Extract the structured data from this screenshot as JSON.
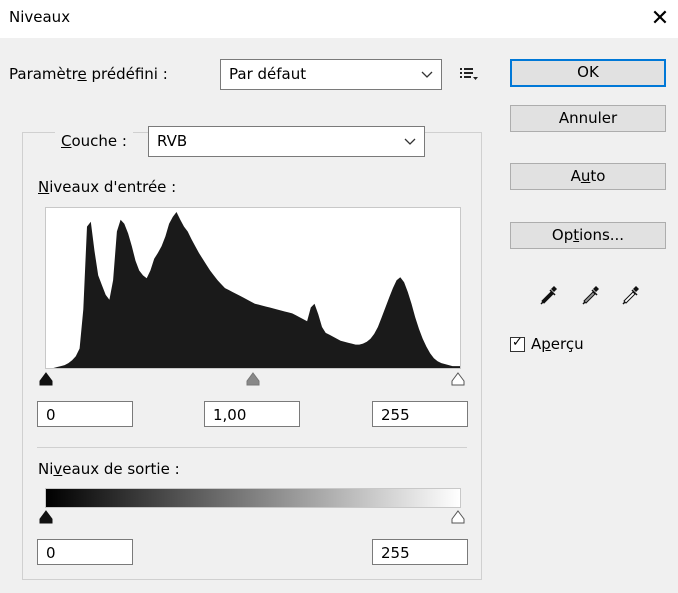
{
  "window": {
    "title": "Niveaux",
    "close_glyph": "✕"
  },
  "preset": {
    "label_pre": "Paramètr",
    "label_u": "e",
    "label_post": " prédéfini :",
    "value": "Par défaut"
  },
  "buttons": {
    "ok": "OK",
    "cancel": "Annuler",
    "auto_pre": "A",
    "auto_u": "u",
    "auto_post": "to",
    "options_pre": "Op",
    "options_u": "t",
    "options_post": "ions..."
  },
  "channel": {
    "label_u": "C",
    "label_post": "ouche :",
    "value": "RVB"
  },
  "input_levels": {
    "label_u": "N",
    "label_post": "iveaux d'entrée :",
    "black": "0",
    "gamma": "1,00",
    "white": "255",
    "black_point": 0,
    "gamma_point": 1.0,
    "white_point": 255
  },
  "output_levels": {
    "label_pre": "Ni",
    "label_u": "v",
    "label_post": "eaux de sortie :",
    "black": "0",
    "white": "255",
    "black_point": 0,
    "white_point": 255
  },
  "preview": {
    "label_pre": "A",
    "label_u": "p",
    "label_post": "erçu",
    "checked": true,
    "check_glyph": "✓"
  },
  "icons": [
    "preset-menu-icon",
    "black-eyedropper-icon",
    "gray-eyedropper-icon",
    "white-eyedropper-icon",
    "chevron-down-icon"
  ],
  "colors": {
    "accent": "#0078d7",
    "histogram": "#1a1a1a"
  },
  "histogram": [
    0,
    0,
    0,
    1,
    2,
    3,
    5,
    8,
    12,
    20,
    60,
    145,
    150,
    120,
    95,
    85,
    75,
    70,
    90,
    140,
    152,
    148,
    138,
    125,
    110,
    100,
    95,
    92,
    100,
    112,
    118,
    125,
    135,
    148,
    155,
    160,
    152,
    145,
    140,
    132,
    125,
    118,
    112,
    106,
    100,
    95,
    90,
    86,
    82,
    80,
    78,
    76,
    74,
    72,
    70,
    68,
    66,
    65,
    64,
    63,
    62,
    61,
    60,
    59,
    58,
    57,
    56,
    54,
    52,
    50,
    48,
    62,
    66,
    55,
    42,
    36,
    34,
    32,
    30,
    28,
    27,
    26,
    25,
    24,
    24,
    25,
    27,
    30,
    35,
    42,
    52,
    62,
    72,
    82,
    90,
    93,
    88,
    78,
    66,
    52,
    40,
    30,
    22,
    15,
    10,
    7,
    5,
    4,
    3,
    2,
    2,
    2
  ]
}
